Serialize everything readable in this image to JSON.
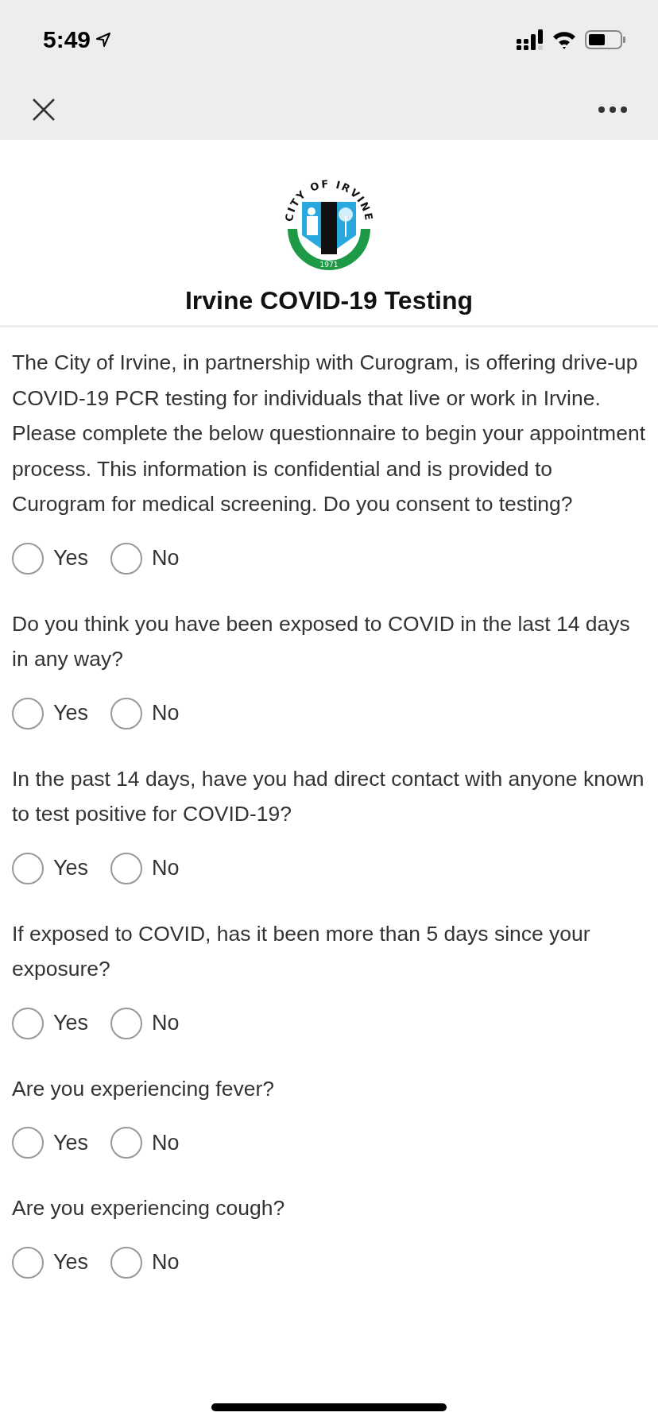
{
  "status_bar": {
    "time": "5:49"
  },
  "logo": {
    "arc_text": "CITY OF IRVINE",
    "year": "1971"
  },
  "title": "Irvine COVID-19 Testing",
  "questions": [
    {
      "text": "The City of Irvine, in partnership with Curogram, is offering drive-up COVID-19 PCR testing for individuals that live or work in Irvine. Please complete the below questionnaire to begin your appointment process. This information is confidential and is provided to Curogram for medical screening. Do you consent to testing?",
      "options": [
        {
          "label": "Yes",
          "selected": false
        },
        {
          "label": "No",
          "selected": false
        }
      ]
    },
    {
      "text": "Do you think you have been exposed to COVID in the last 14 days in any way?",
      "options": [
        {
          "label": "Yes",
          "selected": false
        },
        {
          "label": "No",
          "selected": false
        }
      ]
    },
    {
      "text": "In the past 14 days, have you had direct contact with anyone known to test positive for COVID-19?",
      "options": [
        {
          "label": "Yes",
          "selected": false
        },
        {
          "label": "No",
          "selected": false
        }
      ]
    },
    {
      "text": "If exposed to COVID, has it been more than 5 days since your exposure?",
      "options": [
        {
          "label": "Yes",
          "selected": false
        },
        {
          "label": "No",
          "selected": false
        }
      ]
    },
    {
      "text": "Are you experiencing fever?",
      "options": [
        {
          "label": "Yes",
          "selected": false
        },
        {
          "label": "No",
          "selected": false
        }
      ]
    },
    {
      "text": "Are you experiencing cough?",
      "options": [
        {
          "label": "Yes",
          "selected": false
        },
        {
          "label": "No",
          "selected": false
        }
      ]
    }
  ]
}
